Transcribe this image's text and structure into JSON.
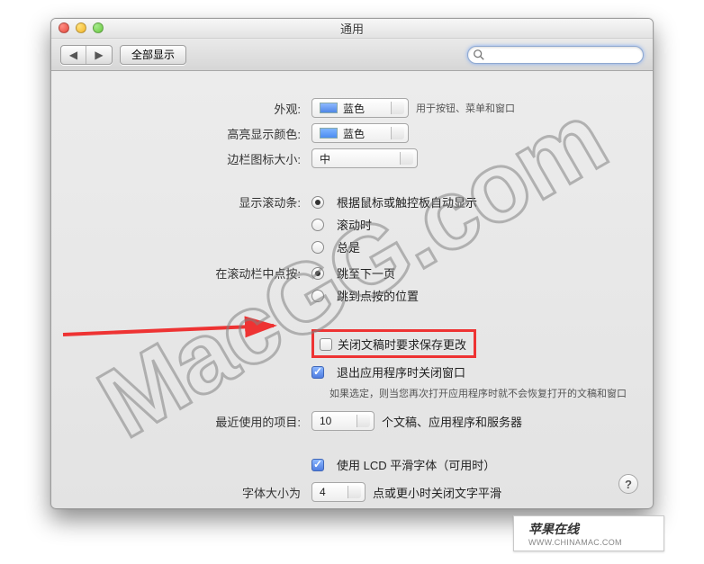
{
  "window": {
    "title": "通用"
  },
  "toolbar": {
    "show_all": "全部显示",
    "search_placeholder": ""
  },
  "rows": {
    "appearance": {
      "label": "外观:",
      "value": "蓝色",
      "hint": "用于按钮、菜单和窗口"
    },
    "highlight": {
      "label": "高亮显示颜色:",
      "value": "蓝色"
    },
    "sidebar_icon": {
      "label": "边栏图标大小:",
      "value": "中"
    },
    "scrollbar": {
      "label": "显示滚动条:",
      "options": [
        "根据鼠标或触控板自动显示",
        "滚动时",
        "总是"
      ],
      "selected": 0
    },
    "scroll_click": {
      "label": "在滚动栏中点按:",
      "options": [
        "跳至下一页",
        "跳到点按的位置"
      ],
      "selected": 0
    },
    "ask_save": {
      "label": "关闭文稿时要求保存更改",
      "checked": false
    },
    "close_windows": {
      "label": "退出应用程序时关闭窗口",
      "checked": true
    },
    "close_hint": "如果选定，则当您再次打开应用程序时就不会恢复打开的文稿和窗口",
    "recent": {
      "label": "最近使用的项目:",
      "value": "10",
      "hint": "个文稿、应用程序和服务器"
    },
    "lcd": {
      "label": "使用 LCD 平滑字体（可用时）",
      "checked": true
    },
    "font_smooth": {
      "label": "字体大小为",
      "value": "4",
      "hint": "点或更小时关闭文字平滑"
    }
  },
  "footer": {
    "brand": "苹果在线",
    "url": "WWW.CHINAMAC.COM"
  },
  "watermark": "MacGG.com"
}
